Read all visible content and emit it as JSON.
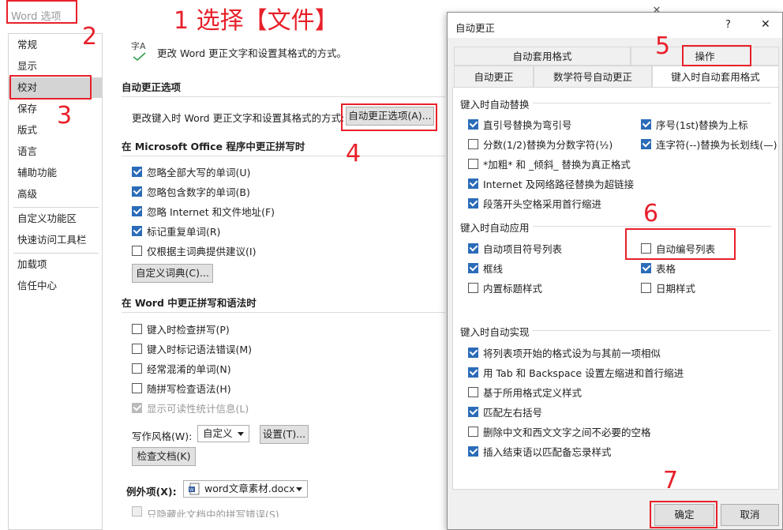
{
  "options_window": {
    "title": "Word 选项",
    "sidebar": [
      "常规",
      "显示",
      "校对",
      "保存",
      "版式",
      "语言",
      "辅助功能",
      "高级",
      "自定义功能区",
      "快速访问工具栏",
      "加载项",
      "信任中心"
    ],
    "header_icon_text": "字A",
    "header_text": "更改 Word 更正文字和设置其格式的方式。",
    "autocorrect_section_title": "自动更正选项",
    "autocorrect_desc": "更改键入时 Word 更正文字和设置其格式的方式:",
    "autocorrect_button": "自动更正选项(A)...",
    "office_section_title": "在 Microsoft Office 程序中更正拼写时",
    "office_checks": [
      {
        "label": "忽略全部大写的单词(U)",
        "checked": true
      },
      {
        "label": "忽略包含数字的单词(B)",
        "checked": true
      },
      {
        "label": "忽略 Internet 和文件地址(F)",
        "checked": true
      },
      {
        "label": "标记重复单词(R)",
        "checked": true
      },
      {
        "label": "仅根据主词典提供建议(I)",
        "checked": false
      }
    ],
    "custom_dict_button": "自定义词典(C)...",
    "word_section_title": "在 Word 中更正拼写和语法时",
    "word_checks": [
      {
        "label": "键入时检查拼写(P)",
        "checked": false
      },
      {
        "label": "键入时标记语法错误(M)",
        "checked": false
      },
      {
        "label": "经常混淆的单词(N)",
        "checked": false
      },
      {
        "label": "随拼写检查语法(H)",
        "checked": false
      },
      {
        "label": "显示可读性统计信息(L)",
        "checked": true,
        "disabled": true
      }
    ],
    "writing_style_label": "写作风格(W):",
    "writing_style_value": "自定义",
    "settings_button": "设置(T)...",
    "check_doc_button": "检查文档(K)",
    "exceptions_label": "例外项(X):",
    "exceptions_value": "word文章素材.docx",
    "truncated_text": "只隐藏此文档中的拼写错误(S)"
  },
  "dialog": {
    "title": "自动更正",
    "help": "?",
    "close": "✕",
    "tabs_row1": [
      "自动套用格式",
      "操作"
    ],
    "tabs_row2": [
      "自动更正",
      "数学符号自动更正",
      "键入时自动套用格式"
    ],
    "group1_title": "键入时自动替换",
    "group1_left": [
      {
        "label": "直引号替换为弯引号",
        "checked": true
      },
      {
        "label": "分数(1/2)替换为分数字符(½)",
        "checked": false
      },
      {
        "label": "*加粗* 和 _倾斜_ 替换为真正格式",
        "checked": false
      },
      {
        "label": "Internet 及网络路径替换为超链接",
        "checked": true
      },
      {
        "label": "段落开头空格采用首行缩进",
        "checked": true
      }
    ],
    "group1_right": [
      {
        "label": "序号(1st)替换为上标",
        "checked": true
      },
      {
        "label": "连字符(--)替换为长划线(—)",
        "checked": true
      }
    ],
    "group2_title": "键入时自动应用",
    "group2_left": [
      {
        "label": "自动项目符号列表",
        "checked": true
      },
      {
        "label": "框线",
        "checked": true
      },
      {
        "label": "内置标题样式",
        "checked": false
      }
    ],
    "group2_right": [
      {
        "label": "自动编号列表",
        "checked": false
      },
      {
        "label": "表格",
        "checked": true
      },
      {
        "label": "日期样式",
        "checked": false
      }
    ],
    "group3_title": "键入时自动实现",
    "group3": [
      {
        "label": "将列表项开始的格式设为与其前一项相似",
        "checked": true
      },
      {
        "label": "用 Tab 和 Backspace 设置左缩进和首行缩进",
        "checked": true
      },
      {
        "label": "基于所用格式定义样式",
        "checked": false
      },
      {
        "label": "匹配左右括号",
        "checked": true
      },
      {
        "label": "删除中文和西文文字之间不必要的空格",
        "checked": false
      },
      {
        "label": "插入结束语以匹配备忘录样式",
        "checked": true
      }
    ],
    "ok": "确定",
    "cancel": "取消"
  },
  "annotations": [
    "1 选择【文件】",
    "2",
    "3",
    "4",
    "5",
    "6",
    "7"
  ],
  "colors": {
    "annotation_red": "#e8202a",
    "check_blue": "#2b6cb8"
  }
}
